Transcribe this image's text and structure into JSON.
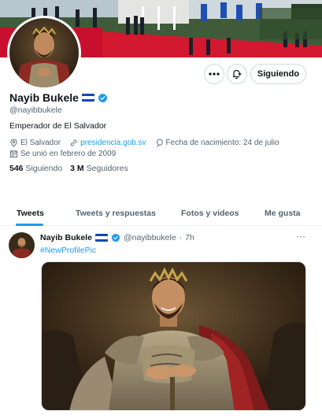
{
  "profile": {
    "display_name": "Nayib Bukele",
    "handle": "@nayibbukele",
    "bio": "Emperador de El Salvador",
    "location": "El Salvador",
    "website": "presidencia.gob.sv",
    "birthday": "Fecha de nacimiento: 24 de julio",
    "joined": "Se unió en febrero de 2009",
    "following_count": "546",
    "following_label": "Siguiendo",
    "followers_count": "3 M",
    "followers_label": "Seguidores",
    "flag_colors": [
      "#0f47af",
      "#ffffff",
      "#0f47af"
    ],
    "verified_color": "#1d9bf0"
  },
  "actions": {
    "more_icon": "more-horizontal-icon",
    "notify_icon": "bell-plus-icon",
    "follow_label": "Siguiendo"
  },
  "tabs": [
    {
      "label": "Tweets",
      "active": true
    },
    {
      "label": "Tweets y respuestas",
      "active": false
    },
    {
      "label": "Fotos y videos",
      "active": false
    },
    {
      "label": "Me gusta",
      "active": false
    }
  ],
  "tweet": {
    "author": "Nayib Bukele",
    "handle": "@nayibbukele",
    "separator": "·",
    "time": "7h",
    "text": "#NewProfilePic",
    "more_label": "···"
  },
  "colors": {
    "accent": "#1d9bf0",
    "text_primary": "#0f1419",
    "text_secondary": "#536471"
  }
}
